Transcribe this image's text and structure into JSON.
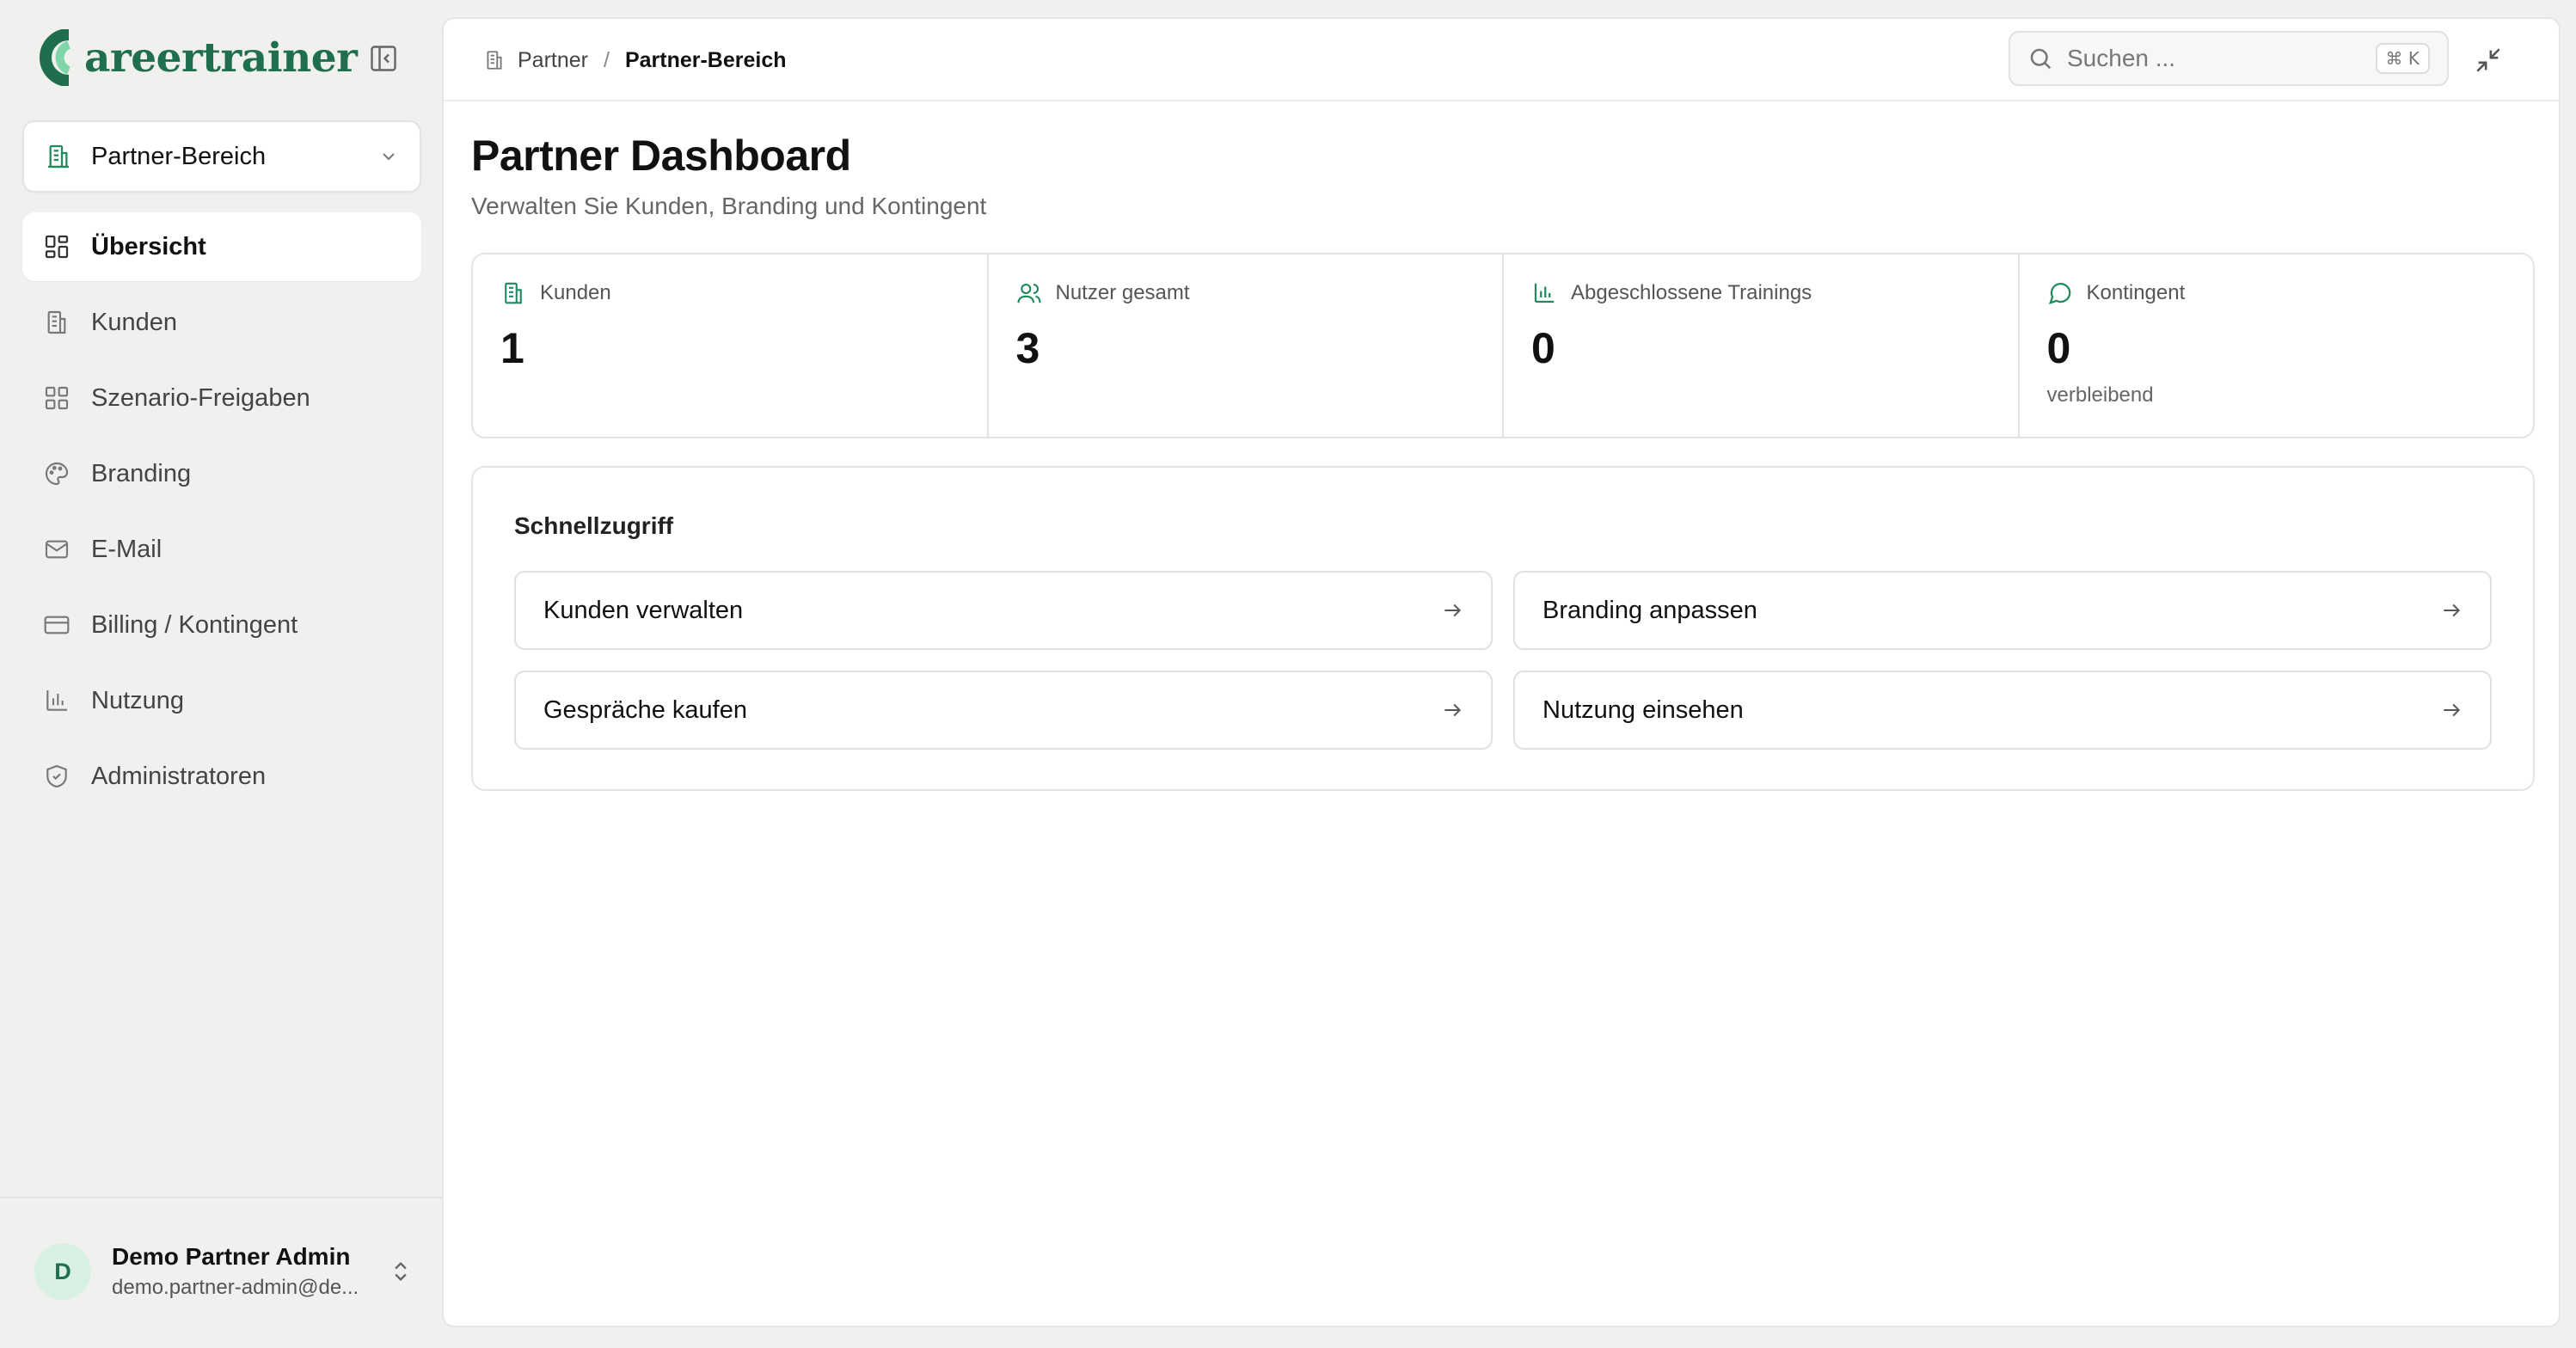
{
  "app": {
    "logo_text": "areertrainer",
    "brand_color": "#1f6f4f"
  },
  "sidebar": {
    "workspace": {
      "label": "Partner-Bereich",
      "icon": "building-icon"
    },
    "items": [
      {
        "label": "Übersicht",
        "icon": "dashboard-icon",
        "active": true
      },
      {
        "label": "Kunden",
        "icon": "building-icon"
      },
      {
        "label": "Szenario-Freigaben",
        "icon": "grid-icon"
      },
      {
        "label": "Branding",
        "icon": "palette-icon"
      },
      {
        "label": "E-Mail",
        "icon": "mail-icon"
      },
      {
        "label": "Billing / Kontingent",
        "icon": "credit-card-icon"
      },
      {
        "label": "Nutzung",
        "icon": "bar-chart-icon"
      },
      {
        "label": "Administratoren",
        "icon": "shield-icon"
      }
    ],
    "user": {
      "initial": "D",
      "name": "Demo Partner Admin",
      "email": "demo.partner-admin@de..."
    }
  },
  "header": {
    "breadcrumb": {
      "parent": "Partner",
      "current": "Partner-Bereich"
    },
    "search": {
      "placeholder": "Suchen ...",
      "shortcut": "⌘ K"
    }
  },
  "page": {
    "title": "Partner Dashboard",
    "subtitle": "Verwalten Sie Kunden, Branding und Kontingent"
  },
  "stats": [
    {
      "label": "Kunden",
      "value": "1",
      "sub": "",
      "icon": "building-icon"
    },
    {
      "label": "Nutzer gesamt",
      "value": "3",
      "sub": "",
      "icon": "users-icon"
    },
    {
      "label": "Abgeschlossene Trainings",
      "value": "0",
      "sub": "",
      "icon": "bar-chart-icon"
    },
    {
      "label": "Kontingent",
      "value": "0",
      "sub": "verbleibend",
      "icon": "message-icon"
    }
  ],
  "quick_access": {
    "title": "Schnellzugriff",
    "buttons": [
      {
        "label": "Kunden verwalten"
      },
      {
        "label": "Branding anpassen"
      },
      {
        "label": "Gespräche kaufen"
      },
      {
        "label": "Nutzung einsehen"
      }
    ]
  }
}
